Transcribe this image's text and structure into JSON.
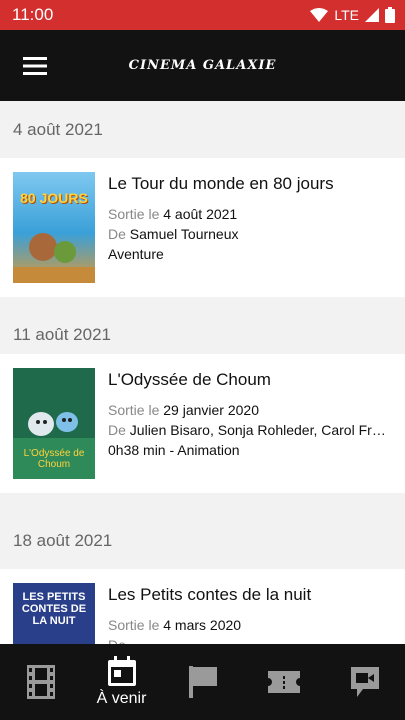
{
  "status": {
    "time": "11:00",
    "network": "LTE"
  },
  "appbar": {
    "logo": "CINEMA GALAXIE"
  },
  "sections": [
    {
      "date": "4 août 2021",
      "movie": {
        "title": "Le Tour du monde en 80 jours",
        "release_label": "Sortie le",
        "release_date": "4 août 2021",
        "director_label": "De",
        "directors": "Samuel Tourneux",
        "extra": "Aventure",
        "poster_text": "80 JOURS"
      }
    },
    {
      "date": "11 août 2021",
      "movie": {
        "title": "L'Odyssée de Choum",
        "release_label": "Sortie le",
        "release_date": "29 janvier 2020",
        "director_label": "De",
        "directors": "Julien Bisaro, Sonja Rohleder, Carol Freeman",
        "extra": "0h38 min - Animation",
        "poster_text": "L'Odyssée de Choum"
      }
    },
    {
      "date": "18 août 2021",
      "movie": {
        "title": "Les Petits contes de la nuit",
        "release_label": "Sortie le",
        "release_date": "4 mars 2020",
        "director_label": "De",
        "directors": "",
        "extra": "",
        "poster_text": "LES PETITS CONTES DE LA NUIT"
      }
    }
  ],
  "nav": [
    {
      "icon": "film-icon",
      "label": ""
    },
    {
      "icon": "calendar-icon",
      "label": "À venir"
    },
    {
      "icon": "flag-icon",
      "label": ""
    },
    {
      "icon": "ticket-icon",
      "label": ""
    },
    {
      "icon": "video-message-icon",
      "label": ""
    }
  ],
  "colors": {
    "status_bar": "#d32f2f",
    "app_bar": "#121212",
    "background": "#f2f2f2"
  }
}
